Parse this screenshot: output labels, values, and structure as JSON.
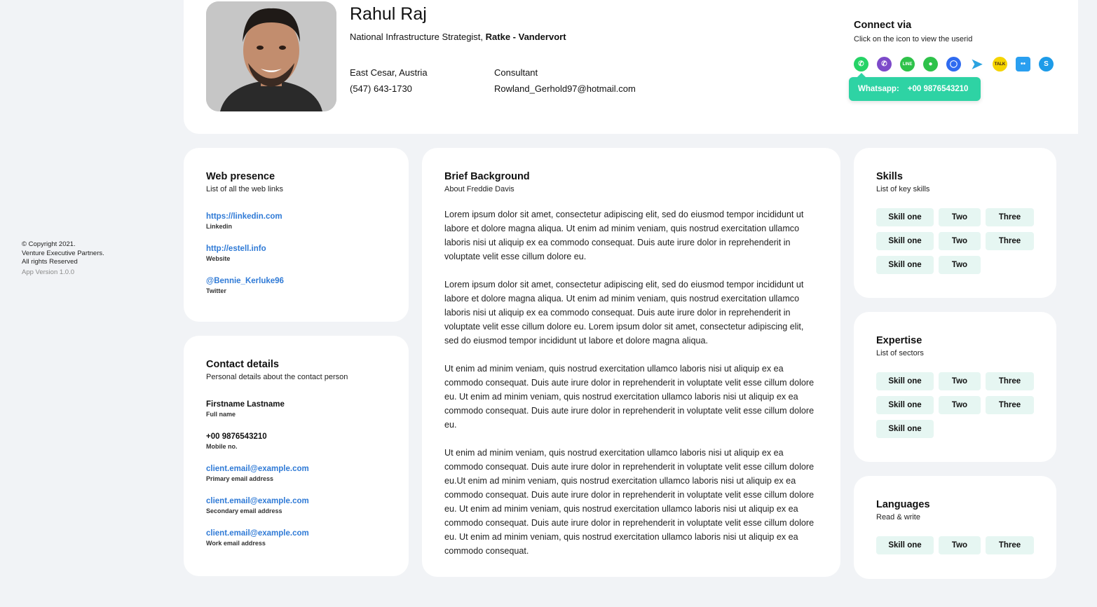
{
  "footer": {
    "copyright": "© Copyright 2021.",
    "company": "Venture Executive Partners.",
    "rights": "All rights Reserved",
    "version": "App Version 1.0.0"
  },
  "profile": {
    "name": "Rahul Raj",
    "role_prefix": "National Infrastructure Strategist, ",
    "company": "Ratke - Vandervort",
    "location": "East Cesar, Austria",
    "phone": "(547) 643-1730",
    "type": "Consultant",
    "email": "Rowland_Gerhold97@hotmail.com"
  },
  "connect": {
    "title": "Connect via",
    "subtitle": "Click on the icon to view the userid",
    "icons": [
      {
        "name": "whatsapp-icon",
        "color": "#25d366"
      },
      {
        "name": "viber-icon",
        "color": "#7d4ac9"
      },
      {
        "name": "line-icon",
        "color": "#2ec24a"
      },
      {
        "name": "wechat-icon",
        "color": "#2ec24a"
      },
      {
        "name": "signal-icon",
        "color": "#2f6bf0"
      },
      {
        "name": "telegram-icon",
        "color": "#2ba3e0"
      },
      {
        "name": "kakaotalk-icon",
        "color": "#f5d400"
      },
      {
        "name": "flickr-icon",
        "color": "#2a9ff0"
      },
      {
        "name": "skype-icon",
        "color": "#1d9be8"
      }
    ],
    "tooltip_label": "Whatsapp:",
    "tooltip_value": "+00 9876543210"
  },
  "web": {
    "title": "Web presence",
    "subtitle": "List of all the web links",
    "items": [
      {
        "value": "https://linkedin.com",
        "label": "Linkedin"
      },
      {
        "value": "http://estell.info",
        "label": "Website"
      },
      {
        "value": "@Bennie_Kerluke96",
        "label": "Twitter"
      }
    ]
  },
  "contact": {
    "title": "Contact details",
    "subtitle": "Personal details about the contact person",
    "items": [
      {
        "value": "Firstname Lastname",
        "label": "Full name"
      },
      {
        "value": "+00 9876543210",
        "label": "Mobile no."
      },
      {
        "value": "client.email@example.com",
        "label": "Primary email address"
      },
      {
        "value": "client.email@example.com",
        "label": "Secondary email address"
      },
      {
        "value": "client.email@example.com",
        "label": "Work email address"
      }
    ]
  },
  "background": {
    "title": "Brief Background",
    "subtitle": "About Freddie Davis",
    "paragraphs": [
      "Lorem ipsum dolor sit amet, consectetur adipiscing elit, sed do eiusmod tempor incididunt ut labore et dolore magna aliqua. Ut enim ad minim veniam, quis nostrud exercitation ullamco laboris nisi ut aliquip ex ea commodo consequat.  Duis aute irure dolor in reprehenderit in voluptate velit esse cillum dolore eu.",
      "Lorem ipsum dolor sit amet, consectetur adipiscing elit, sed do eiusmod tempor incididunt ut labore et dolore magna aliqua. Ut enim ad minim veniam, quis nostrud exercitation ullamco laboris nisi ut aliquip ex ea commodo consequat.  Duis aute irure dolor in reprehenderit in voluptate velit esse cillum dolore eu. Lorem ipsum dolor sit amet, consectetur adipiscing elit, sed do eiusmod tempor incididunt ut labore et dolore magna aliqua.",
      "Ut enim ad minim veniam, quis nostrud exercitation ullamco laboris nisi ut aliquip ex ea commodo consequat.  Duis aute irure dolor in reprehenderit in voluptate velit esse cillum dolore eu. Ut enim ad minim veniam, quis nostrud exercitation ullamco laboris nisi ut aliquip ex ea commodo consequat.  Duis aute irure dolor in reprehenderit in voluptate velit esse cillum dolore eu.",
      "Ut enim ad minim veniam, quis nostrud exercitation ullamco laboris nisi ut aliquip ex ea commodo consequat.  Duis aute irure dolor in reprehenderit in voluptate velit esse cillum dolore eu.Ut enim ad minim veniam, quis nostrud exercitation ullamco laboris nisi ut aliquip ex ea commodo consequat.  Duis aute irure dolor in reprehenderit in voluptate velit esse cillum dolore eu. Ut enim ad minim veniam, quis nostrud exercitation ullamco laboris nisi ut aliquip ex ea commodo consequat.  Duis aute irure dolor in reprehenderit in voluptate velit esse cillum dolore eu. Ut enim ad minim veniam, quis nostrud exercitation ullamco laboris nisi ut aliquip ex ea commodo consequat."
    ]
  },
  "skills": {
    "title": "Skills",
    "subtitle": "List of key skills",
    "chips": [
      "Skill one",
      "Two",
      "Three",
      "Skill one",
      "Two",
      "Three",
      "Skill one",
      "Two"
    ]
  },
  "expertise": {
    "title": "Expertise",
    "subtitle": "List of sectors",
    "chips": [
      "Skill one",
      "Two",
      "Three",
      "Skill one",
      "Two",
      "Three",
      "Skill one"
    ]
  },
  "languages": {
    "title": "Languages",
    "subtitle": "Read & write",
    "chips": [
      "Skill one",
      "Two",
      "Three"
    ]
  }
}
